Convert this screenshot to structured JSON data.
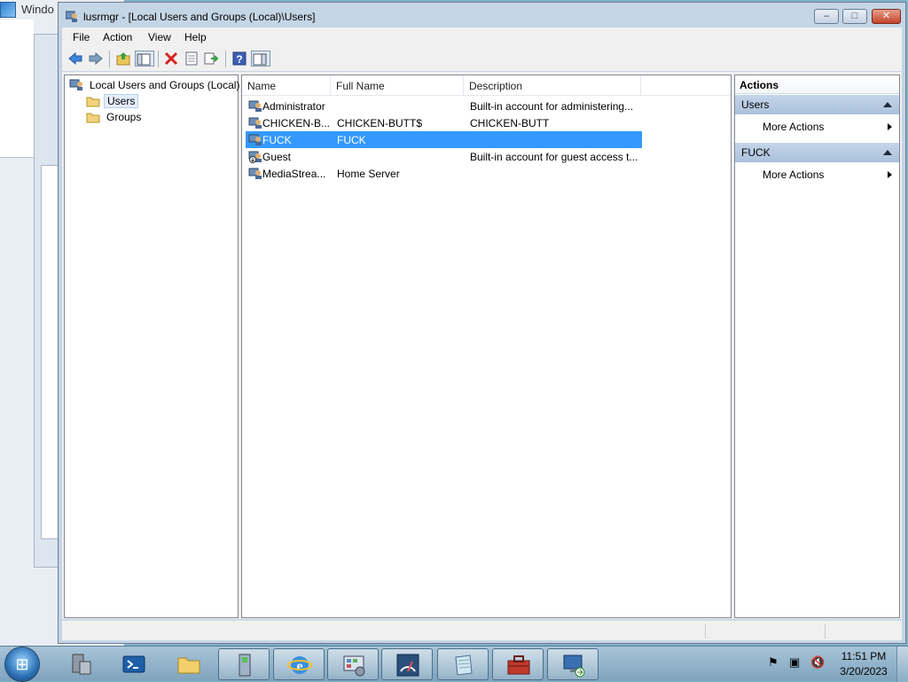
{
  "background_window": {
    "title": "Windo"
  },
  "window": {
    "title": "lusrmgr - [Local Users and Groups (Local)\\Users]",
    "controls": {
      "minimize": "–",
      "maximize": "□",
      "close": "✕"
    }
  },
  "menu": [
    "File",
    "Action",
    "View",
    "Help"
  ],
  "toolbar": {
    "buttons": [
      "back-icon",
      "forward-icon",
      "up-folder-icon",
      "show-hide-tree-icon",
      "delete-icon",
      "properties-icon",
      "export-list-icon",
      "help-icon",
      "show-hide-action-pane-icon"
    ]
  },
  "tree": {
    "root": "Local Users and Groups (Local)",
    "children": [
      "Users",
      "Groups"
    ],
    "selected": "Users"
  },
  "list": {
    "columns": [
      "Name",
      "Full Name",
      "Description"
    ],
    "rows": [
      {
        "name": "Administrator",
        "full_name": "",
        "description": "Built-in account for administering..."
      },
      {
        "name": "CHICKEN-B...",
        "full_name": "CHICKEN-BUTT$",
        "description": "CHICKEN-BUTT"
      },
      {
        "name": "FUCK",
        "full_name": "FUCK",
        "description": ""
      },
      {
        "name": "Guest",
        "full_name": "",
        "description": "Built-in account for guest access t..."
      },
      {
        "name": "MediaStrea...",
        "full_name": "Home Server",
        "description": ""
      }
    ],
    "selected_row": "FUCK"
  },
  "actions": {
    "header": "Actions",
    "sections": [
      {
        "title": "Users",
        "item": "More Actions"
      },
      {
        "title": "FUCK",
        "item": "More Actions"
      }
    ]
  },
  "taskbar": {
    "start": "⊞",
    "pinned": [
      "server-manager-icon",
      "powershell-icon",
      "explorer-folder-icon",
      "removable-storage-icon",
      "internet-explorer-icon",
      "control-panel-icon",
      "performance-gauge-icon",
      "notepad-icon",
      "toolbox-icon",
      "remote-desktop-icon"
    ],
    "tray": {
      "flag": "⚑",
      "network": "▣",
      "volume": "🔇"
    },
    "time": "11:51 PM",
    "date": "3/20/2023"
  },
  "colors": {
    "selection": "#3399ff",
    "action_section": "#b7cbe2",
    "close_button": "#c4432a"
  }
}
